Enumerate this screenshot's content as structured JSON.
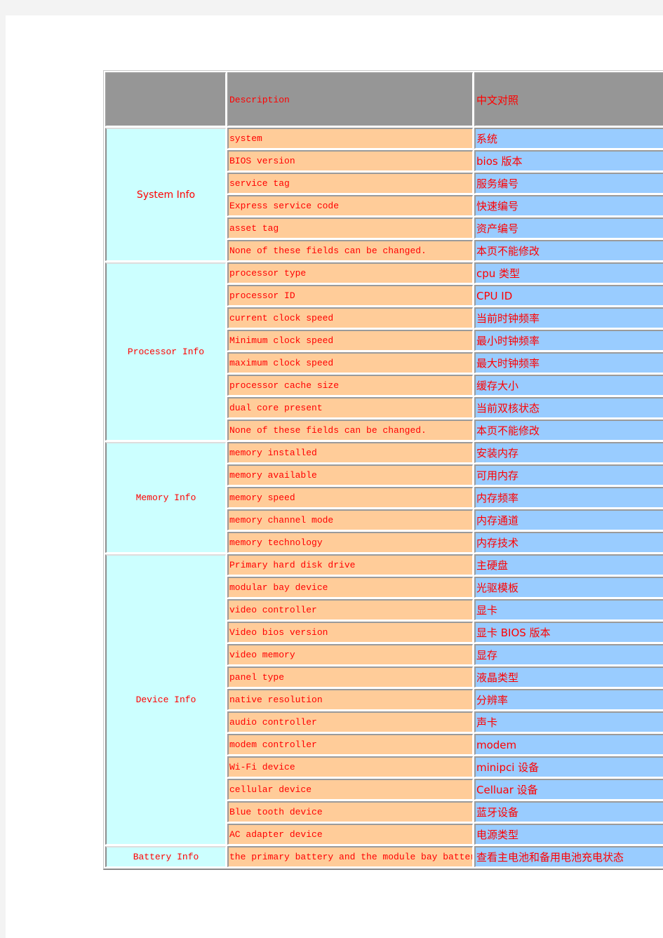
{
  "table": {
    "header": {
      "category": "",
      "description": "Description",
      "chinese": "中文对照"
    },
    "colors": {
      "header_bg": "#969696",
      "category_bg": "#ccffff",
      "description_bg": "#ffcc99",
      "chinese_bg": "#99ccff",
      "text": "#ff0000"
    },
    "groups": [
      {
        "category": "System Info",
        "rows": [
          {
            "description": "system",
            "chinese": "系统"
          },
          {
            "description": "BIOS version",
            "chinese": "bios 版本"
          },
          {
            "description": "service tag",
            "chinese": "服务编号"
          },
          {
            "description": "Express service code",
            "chinese": "快速编号"
          },
          {
            "description": "asset tag",
            "chinese": "资产编号"
          },
          {
            "description": "None of these fields can be changed.",
            "chinese": "本页不能修改"
          }
        ]
      },
      {
        "category": "Processor Info",
        "rows": [
          {
            "description": "processor type",
            "chinese": "cpu 类型"
          },
          {
            "description": "processor ID",
            "chinese": "CPU ID"
          },
          {
            "description": "current clock speed",
            "chinese": "当前时钟频率"
          },
          {
            "description": "Minimum clock speed",
            "chinese": "最小时钟频率"
          },
          {
            "description": "maximum clock speed",
            "chinese": "最大时钟频率"
          },
          {
            "description": "processor cache size",
            "chinese": "缓存大小"
          },
          {
            "description": "dual core present",
            "chinese": "当前双核状态"
          },
          {
            "description": "None of these fields can be changed.",
            "chinese": "本页不能修改"
          }
        ]
      },
      {
        "category": "Memory Info",
        "rows": [
          {
            "description": "memory installed",
            "chinese": "安装内存"
          },
          {
            "description": "memory available",
            "chinese": "可用内存"
          },
          {
            "description": "memory speed",
            "chinese": "内存频率"
          },
          {
            "description": "memory channel mode",
            "chinese": "内存通道"
          },
          {
            "description": "memory technology",
            "chinese": "内存技术"
          }
        ]
      },
      {
        "category": "Device Info",
        "rows": [
          {
            "description": "Primary hard disk drive",
            "chinese": "主硬盘"
          },
          {
            "description": "modular bay device",
            "chinese": "光驱模板"
          },
          {
            "description": "video controller",
            "chinese": "显卡"
          },
          {
            "description": "Video bios version",
            "chinese": "显卡 BIOS 版本"
          },
          {
            "description": "video memory",
            "chinese": "显存"
          },
          {
            "description": "panel type",
            "chinese": "液晶类型"
          },
          {
            "description": "native resolution",
            "chinese": "分辨率"
          },
          {
            "description": "audio controller",
            "chinese": "声卡"
          },
          {
            "description": "modem controller",
            "chinese": "modem"
          },
          {
            "description": "Wi-Fi device",
            "chinese": "minipci 设备"
          },
          {
            "description": "cellular device",
            "chinese": "Celluar 设备"
          },
          {
            "description": "Blue tooth device",
            "chinese": "蓝牙设备"
          },
          {
            "description": "AC adapter device",
            "chinese": "电源类型"
          }
        ]
      },
      {
        "category": "Battery Info",
        "rows": [
          {
            "description": "the primary battery and the module bay battery",
            "chinese": "查看主电池和备用电池充电状态"
          }
        ]
      }
    ]
  }
}
